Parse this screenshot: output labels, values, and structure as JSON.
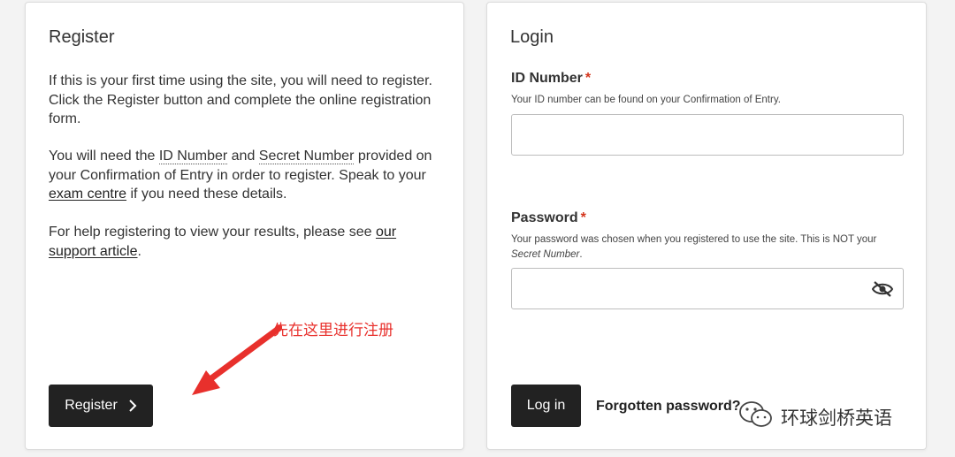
{
  "register": {
    "title": "Register",
    "p1": "If this is your first time using the site, you will need to register. Click the Register button and complete the online registration form.",
    "p2_a": "You will need the ",
    "p2_id": "ID Number",
    "p2_and": " and ",
    "p2_secret": "Secret Number",
    "p2_b": " provided on your Confirmation of Entry in order to register. Speak to your ",
    "p2_link": "exam centre",
    "p2_c": " if you need these details.",
    "p3_a": "For help registering to view your results, please see ",
    "p3_link": "our support article",
    "p3_b": ".",
    "button_label": "Register",
    "button_icon": "chevron-right-icon"
  },
  "annotation": {
    "text": "先在这里进行注册",
    "color": "#e8302c"
  },
  "login": {
    "title": "Login",
    "id_label": "ID Number",
    "id_required": "*",
    "id_hint": "Your ID number can be found on your Confirmation of Entry.",
    "id_value": "",
    "password_label": "Password",
    "password_required": "*",
    "password_hint_a": "Your password was chosen when you registered to use the site. This is NOT your ",
    "password_hint_em": "Secret Number",
    "password_hint_b": ".",
    "password_value": "",
    "eye_icon": "eye-slash-icon",
    "button_label": "Log in",
    "forgot_label": "Forgotten password?"
  },
  "watermark": {
    "text": "环球剑桥英语",
    "icon": "wechat-icon"
  },
  "colors": {
    "button_bg": "#222222",
    "required": "#d4351c",
    "page_bg": "#f3f3f3"
  }
}
